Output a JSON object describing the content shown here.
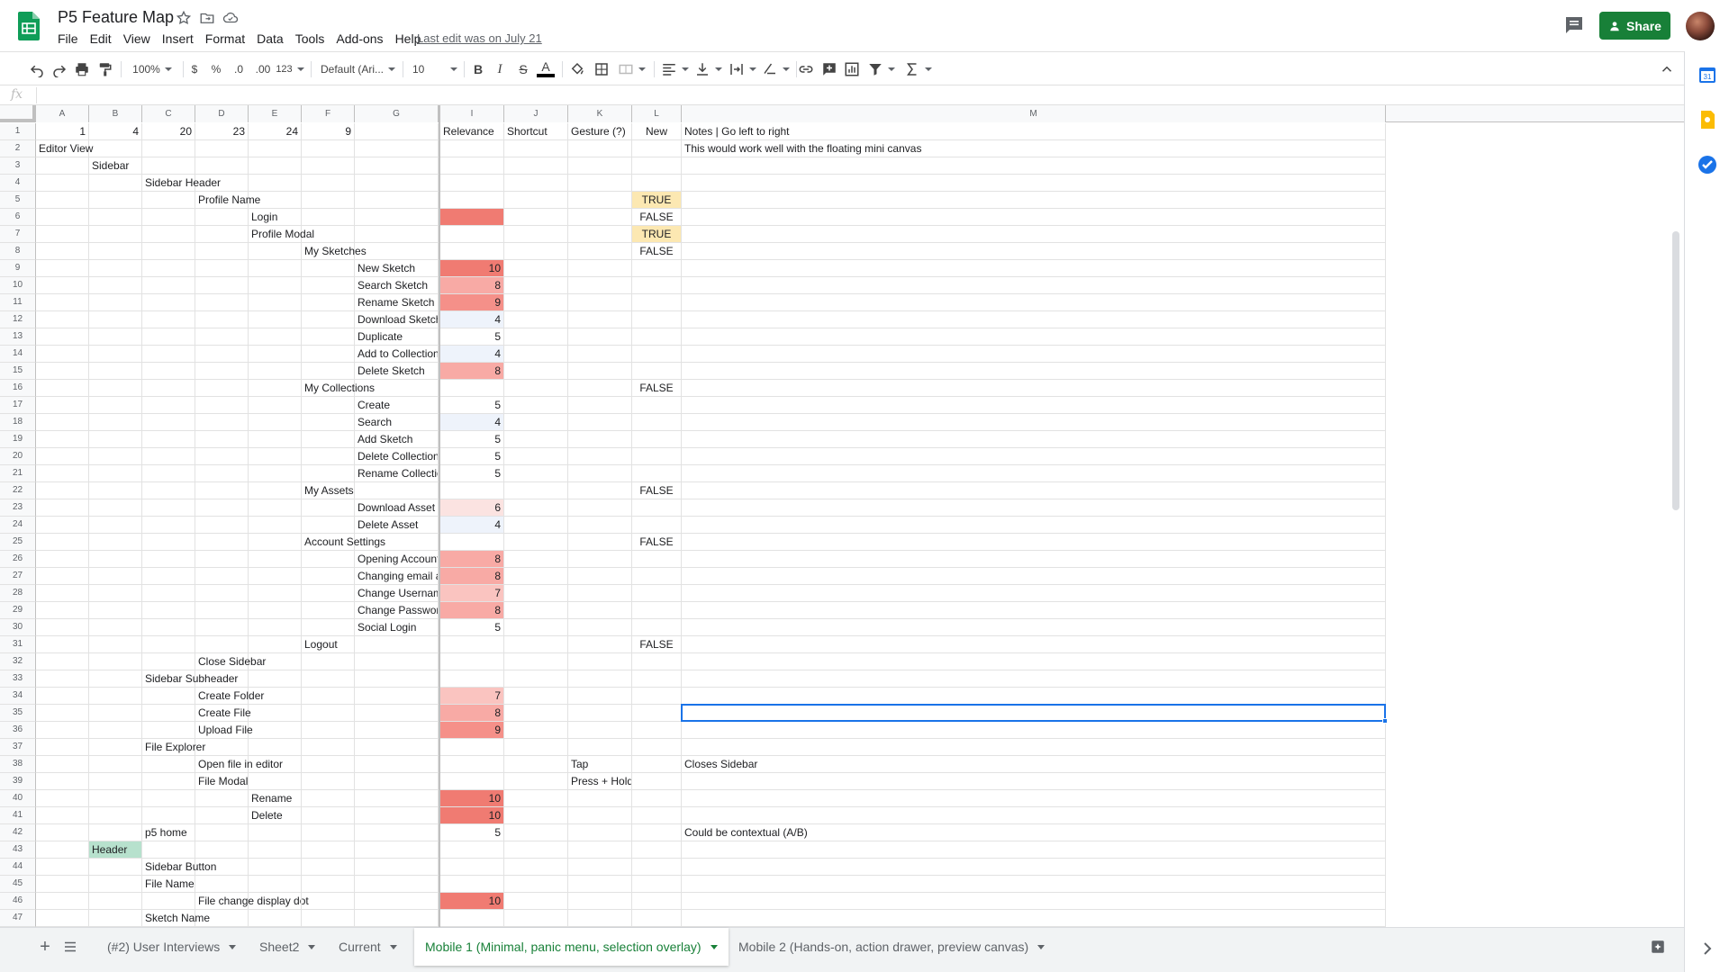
{
  "title": "P5 Feature Map",
  "menu": [
    "File",
    "Edit",
    "View",
    "Insert",
    "Format",
    "Data",
    "Tools",
    "Add-ons",
    "Help"
  ],
  "last_edit": "Last edit was on July 21",
  "share_label": "Share",
  "toolbar": {
    "zoom": "100%",
    "currency": "$",
    "percent": "%",
    "dec_decrease": ".0",
    "dec_increase": ".00",
    "more_formats": "123",
    "font": "Default (Ari...",
    "font_size": "10",
    "bold": "B",
    "italic": "I",
    "strike": "S",
    "text_color": "A"
  },
  "formula": {
    "fx": "fx",
    "value": ""
  },
  "columns": [
    "A",
    "B",
    "C",
    "D",
    "E",
    "F",
    "G",
    "I",
    "J",
    "K",
    "L",
    "M"
  ],
  "rows": [
    {
      "n": "1",
      "cells": {
        "A": "1",
        "B": "4",
        "C": "20",
        "D": "23",
        "E": "24",
        "F": "9",
        "I": "Relevance",
        "J": "Shortcut",
        "K": "Gesture (?)",
        "L": "New",
        "M": "Notes | Go left to right"
      }
    },
    {
      "n": "2",
      "cells": {
        "A": "Editor View",
        "M": "This would work well with the floating mini canvas"
      }
    },
    {
      "n": "3",
      "cells": {
        "B": "Sidebar"
      }
    },
    {
      "n": "4",
      "cells": {
        "C": "Sidebar Header"
      }
    },
    {
      "n": "5",
      "cells": {
        "D": "Profile Name",
        "L": "TRUE"
      }
    },
    {
      "n": "6",
      "cells": {
        "E": "Login",
        "L": "FALSE"
      }
    },
    {
      "n": "7",
      "cells": {
        "E": "Profile Modal",
        "L": "TRUE"
      }
    },
    {
      "n": "8",
      "cells": {
        "F": "My Sketches",
        "L": "FALSE"
      }
    },
    {
      "n": "9",
      "cells": {
        "G": "New Sketch",
        "I": "10"
      }
    },
    {
      "n": "10",
      "cells": {
        "G": "Search Sketch",
        "I": "8"
      }
    },
    {
      "n": "11",
      "cells": {
        "G": "Rename Sketch",
        "I": "9"
      }
    },
    {
      "n": "12",
      "cells": {
        "G": "Download Sketch",
        "I": "4"
      }
    },
    {
      "n": "13",
      "cells": {
        "G": "Duplicate",
        "I": "5"
      }
    },
    {
      "n": "14",
      "cells": {
        "G": "Add to Collection",
        "I": "4"
      }
    },
    {
      "n": "15",
      "cells": {
        "G": "Delete Sketch",
        "I": "8"
      }
    },
    {
      "n": "16",
      "cells": {
        "F": "My Collections",
        "L": "FALSE"
      }
    },
    {
      "n": "17",
      "cells": {
        "G": "Create",
        "I": "5"
      }
    },
    {
      "n": "18",
      "cells": {
        "G": "Search",
        "I": "4"
      }
    },
    {
      "n": "19",
      "cells": {
        "G": "Add Sketch",
        "I": "5"
      }
    },
    {
      "n": "20",
      "cells": {
        "G": "Delete Collection",
        "I": "5"
      }
    },
    {
      "n": "21",
      "cells": {
        "G": "Rename Collectio",
        "I": "5"
      }
    },
    {
      "n": "22",
      "cells": {
        "F": "My Assets",
        "L": "FALSE"
      }
    },
    {
      "n": "23",
      "cells": {
        "G": "Download Asset",
        "I": "6"
      }
    },
    {
      "n": "24",
      "cells": {
        "G": "Delete Asset",
        "I": "4"
      }
    },
    {
      "n": "25",
      "cells": {
        "F": "Account Settings",
        "L": "FALSE"
      }
    },
    {
      "n": "26",
      "cells": {
        "G": "Opening Account",
        "I": "8"
      }
    },
    {
      "n": "27",
      "cells": {
        "G": "Changing email a",
        "I": "8"
      }
    },
    {
      "n": "28",
      "cells": {
        "G": "Change Usernam",
        "I": "7"
      }
    },
    {
      "n": "29",
      "cells": {
        "G": "Change Passwor",
        "I": "8"
      }
    },
    {
      "n": "30",
      "cells": {
        "G": "Social Login",
        "I": "5"
      }
    },
    {
      "n": "31",
      "cells": {
        "F": "Logout",
        "L": "FALSE"
      }
    },
    {
      "n": "32",
      "cells": {
        "D": "Close Sidebar"
      }
    },
    {
      "n": "33",
      "cells": {
        "C": "Sidebar Subheader"
      }
    },
    {
      "n": "34",
      "cells": {
        "D": "Create Folder",
        "I": "7"
      }
    },
    {
      "n": "35",
      "cells": {
        "D": "Create File",
        "I": "8"
      }
    },
    {
      "n": "36",
      "cells": {
        "D": "Upload File",
        "I": "9"
      }
    },
    {
      "n": "37",
      "cells": {
        "C": "File Explorer"
      }
    },
    {
      "n": "38",
      "cells": {
        "D": "Open file in editor",
        "K": "Tap",
        "M": "Closes Sidebar"
      }
    },
    {
      "n": "39",
      "cells": {
        "D": "File Modal",
        "K": "Press + Hold"
      }
    },
    {
      "n": "40",
      "cells": {
        "E": "Rename",
        "I": "10"
      }
    },
    {
      "n": "41",
      "cells": {
        "E": "Delete",
        "I": "10"
      }
    },
    {
      "n": "42",
      "cells": {
        "C": "p5 home",
        "I": "5",
        "M": "Could be contextual (A/B)"
      }
    },
    {
      "n": "43",
      "cells": {
        "B": "Header"
      }
    },
    {
      "n": "44",
      "cells": {
        "C": "Sidebar Button"
      }
    },
    {
      "n": "45",
      "cells": {
        "C": "File Name"
      }
    },
    {
      "n": "46",
      "cells": {
        "D": "File change display dot",
        "I": "10"
      }
    },
    {
      "n": "47",
      "cells": {
        "C": "Sketch Name"
      }
    }
  ],
  "cell_fills": {
    "6-I": "#f07b72",
    "9-I": "#f07b72",
    "10-I": "#f8aaa5",
    "11-I": "#f59089",
    "12-I": "#eef3fb",
    "14-I": "#eef3fb",
    "15-I": "#f8aaa5",
    "18-I": "#eef3fb",
    "23-I": "#fbe3e1",
    "24-I": "#eef3fb",
    "26-I": "#f8aaa5",
    "27-I": "#f8aaa5",
    "28-I": "#fac4c0",
    "29-I": "#f8aaa5",
    "34-I": "#fac4c0",
    "35-I": "#f8aaa5",
    "36-I": "#f59089",
    "40-I": "#f07b72",
    "41-I": "#f07b72",
    "46-I": "#f07b72",
    "5-L": "#fce8b2",
    "7-L": "#fce8b2",
    "43-B": "#b7e1cd"
  },
  "sheets": [
    {
      "label": "(#2) User Interviews",
      "active": false
    },
    {
      "label": "Sheet2",
      "active": false
    },
    {
      "label": "Current",
      "active": false
    },
    {
      "label": "Mobile 1 (Minimal, panic menu, selection overlay)",
      "active": true
    },
    {
      "label": "Mobile 2 (Hands-on, action drawer, preview canvas)",
      "active": false
    }
  ],
  "colors": {
    "share": "#188038",
    "selection": "#1a73e8",
    "sheets_green": "#0f9d58"
  }
}
